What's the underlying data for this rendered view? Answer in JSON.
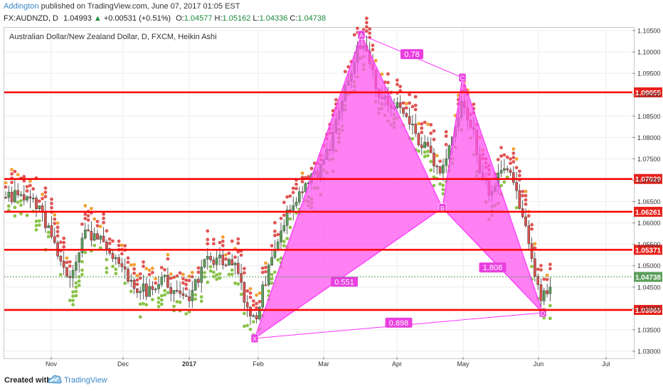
{
  "header": {
    "author": "Addington",
    "published": "published on TradingView.com, June 07, 2017 01:05 EST",
    "symbol": "FX:AUDNZD, D",
    "last": "1.04993",
    "change": "+0.00531 (+0.51%)",
    "o_label": "O:",
    "o_value": "1.04577",
    "h_label": "H:",
    "h_value": "1.05162",
    "l_label": "L:",
    "l_value": "1.04336",
    "c_label": "C:",
    "c_value": "1.04738"
  },
  "pane": {
    "title": "Australian Dollar/New Zealand Dollar, D, FXCM, Heikin Ashi"
  },
  "footer": {
    "created_with": "Created with",
    "brand": "TradingView"
  },
  "colors": {
    "bull": "#5a9e5a",
    "bear": "#d9534f",
    "level": "#ff0000",
    "pattern": "#ff33ff",
    "pattern_fill": "#ff55ee",
    "dot_red": "#e05555",
    "dot_orange": "#f2a033",
    "dot_green": "#8bc34a"
  },
  "chart_data": {
    "type": "candlestick",
    "chart_style": "Heikin Ashi",
    "ylim": [
      1.028,
      1.106
    ],
    "y_ticks": [
      "1.10500",
      "1.10000",
      "1.09500",
      "1.09000",
      "1.08500",
      "1.08000",
      "1.07500",
      "1.07000",
      "1.06500",
      "1.06000",
      "1.05500",
      "1.05000",
      "1.04500",
      "1.04000",
      "1.03500",
      "1.03000"
    ],
    "x_ticks": [
      "Nov",
      "Dec",
      "2017",
      "Feb",
      "Mar",
      "Apr",
      "May",
      "Jun",
      "Jul"
    ],
    "levels": [
      {
        "label": "1.09055",
        "value": 1.09055
      },
      {
        "label": "1.07029",
        "value": 1.07029
      },
      {
        "label": "1.06261",
        "value": 1.06261
      },
      {
        "label": "1.05371",
        "value": 1.05371
      },
      {
        "label": "1.03965",
        "value": 1.03965
      }
    ],
    "last_price": {
      "label": "1.04738",
      "value": 1.04738
    },
    "pattern_points": [
      {
        "label": "X",
        "month": "Feb",
        "price": 1.033
      },
      {
        "label": "A",
        "month": "Mar",
        "price": 1.104
      },
      {
        "label": "B",
        "month": "Apr",
        "price": 1.0635
      },
      {
        "label": "C",
        "month": "May",
        "price": 1.094
      },
      {
        "label": "D",
        "month": "Jun",
        "price": 1.039
      }
    ],
    "ratios": [
      "0.551",
      "0.78",
      "1.808",
      "0.898"
    ]
  }
}
